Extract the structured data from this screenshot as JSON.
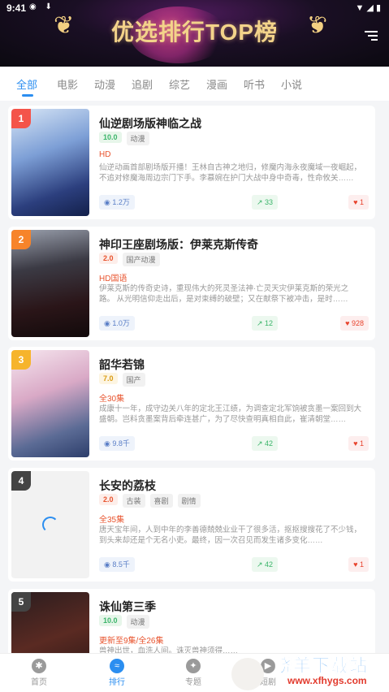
{
  "status_bar": {
    "time": "9:41"
  },
  "header": {
    "title": "优选排行TOP榜"
  },
  "tabs": [
    {
      "label": "全部",
      "active": true
    },
    {
      "label": "电影"
    },
    {
      "label": "动漫"
    },
    {
      "label": "追剧"
    },
    {
      "label": "综艺"
    },
    {
      "label": "漫画"
    },
    {
      "label": "听书"
    },
    {
      "label": "小说"
    }
  ],
  "items": [
    {
      "rank": "1",
      "title": "仙逆剧场版神临之战",
      "score": "10.0",
      "tags": [
        "动漫"
      ],
      "status": "HD",
      "desc": "仙逆动画首部剧场版开播！王林自古神之地归，修魔内海永夜魔域一夜崛起，不追对修魔海周边宗门下手。李慕婉在护门大战中身中奇毒，性命攸关……",
      "views": "1.2万",
      "trend": "33",
      "likes": "1"
    },
    {
      "rank": "2",
      "title": "神印王座剧场版：伊莱克斯传奇",
      "score": "2.0",
      "tags": [
        "国产动漫"
      ],
      "status": "HD国语",
      "desc": "伊莱克斯的传奇史诗，重现伟大的死灵圣法神·亡灵天灾伊莱克斯的荣光之路。 从光明信仰走出后，是对束缚的破壁；又在献祭下被冲击，是时……",
      "views": "1.0万",
      "trend": "12",
      "likes": "928"
    },
    {
      "rank": "3",
      "title": "韶华若锦",
      "score": "7.0",
      "tags": [
        "国产"
      ],
      "status": "全30集",
      "desc": "成康十一年，成守边关八年的定北王江绩，为调查定北军饷被贪墨一案回到大盛朝。岂料贪墨案背后牵连甚广，为了尽快查明真相自此，崔清朝堂……",
      "views": "9.8千",
      "trend": "42",
      "likes": "1"
    },
    {
      "rank": "4",
      "title": "长安的荔枝",
      "score": "2.0",
      "tags": [
        "古装",
        "喜剧",
        "剧情"
      ],
      "status": "全35集",
      "desc": "唐天宝年间，人到中年的李善德兢兢业业干了很多活，抠抠搜搜花了不少钱，到头来却还是个无名小吏。最终，因一次召见而发生诸多变化……",
      "views": "8.5千",
      "trend": "42",
      "likes": "1"
    },
    {
      "rank": "5",
      "title": "诛仙第三季",
      "score": "10.0",
      "tags": [
        "动漫"
      ],
      "status": "更新至9集/全26集",
      "desc": "兽神出世，血洗人间。诛灭兽神须得……",
      "views": "",
      "trend": "",
      "likes": ""
    }
  ],
  "bottom_nav": [
    {
      "label": "首页",
      "icon": "home-icon"
    },
    {
      "label": "排行",
      "icon": "rank-icon",
      "active": true
    },
    {
      "label": "专题",
      "icon": "topic-icon"
    },
    {
      "label": "短剧",
      "icon": "play-icon"
    }
  ],
  "watermark": {
    "text": "晓羊下载站",
    "url": "www.xfhygs.com"
  },
  "colors": {
    "accent": "#2b8ef0",
    "rank1": "#f4544a",
    "rank2": "#f7842a",
    "rank3": "#f6b42c",
    "rank_other": "#444444"
  }
}
